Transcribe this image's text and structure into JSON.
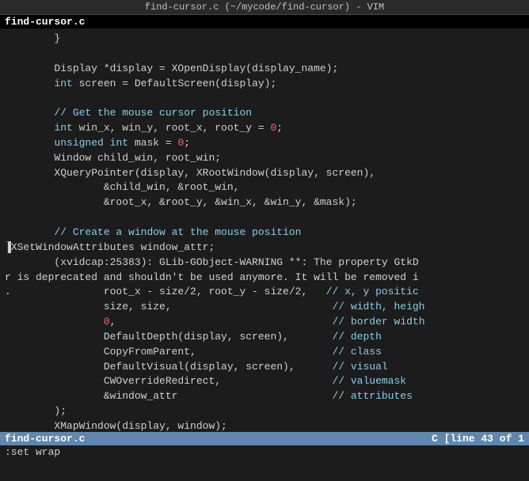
{
  "titleBar": {
    "text": "find-cursor.c (~/mycode/find-cursor) - VIM"
  },
  "filenameBar": {
    "text": "find-cursor.c"
  },
  "statusBar": {
    "left": "find-cursor.c",
    "right": "C [line 43 of 1"
  },
  "cmdBar": {
    "text": ":set wrap"
  },
  "code": {
    "lines": [
      {
        "text": "        }",
        "parts": [
          {
            "t": "        }",
            "cls": "plain"
          }
        ]
      },
      {
        "text": "",
        "parts": []
      },
      {
        "text": "        Display *display = XOpenDisplay(display_name);",
        "parts": [
          {
            "t": "        Display *display = XOpenDisplay(display_name);",
            "cls": "plain"
          }
        ]
      },
      {
        "text": "        int screen = DefaultScreen(display);",
        "parts": [
          {
            "t": "        ",
            "cls": "plain"
          },
          {
            "t": "int",
            "cls": "kw"
          },
          {
            "t": " screen = DefaultScreen(display);",
            "cls": "plain"
          }
        ]
      },
      {
        "text": "",
        "parts": []
      },
      {
        "text": "        // Get the mouse cursor position",
        "parts": [
          {
            "t": "        ",
            "cls": "plain"
          },
          {
            "t": "// Get the mouse cursor position",
            "cls": "cm"
          }
        ]
      },
      {
        "text": "        int win_x, win_y, root_x, root_y = 0;",
        "parts": [
          {
            "t": "        ",
            "cls": "plain"
          },
          {
            "t": "int",
            "cls": "kw"
          },
          {
            "t": " win_x, win_y, root_x, root_y = ",
            "cls": "plain"
          },
          {
            "t": "0",
            "cls": "num"
          },
          {
            "t": ";",
            "cls": "plain"
          }
        ]
      },
      {
        "text": "        unsigned int mask = 0;",
        "parts": [
          {
            "t": "        ",
            "cls": "plain"
          },
          {
            "t": "unsigned",
            "cls": "kw"
          },
          {
            "t": " ",
            "cls": "plain"
          },
          {
            "t": "int",
            "cls": "kw"
          },
          {
            "t": " mask = ",
            "cls": "plain"
          },
          {
            "t": "0",
            "cls": "num"
          },
          {
            "t": ";",
            "cls": "plain"
          }
        ]
      },
      {
        "text": "        Window child_win, root_win;",
        "parts": [
          {
            "t": "        Window child_win, root_win;",
            "cls": "plain"
          }
        ]
      },
      {
        "text": "        XQueryPointer(display, XRootWindow(display, screen),",
        "parts": [
          {
            "t": "        XQueryPointer(display, XRootWindow(display, screen),",
            "cls": "plain"
          }
        ]
      },
      {
        "text": "                &child_win, &root_win,",
        "parts": [
          {
            "t": "                &child_win, &root_win,",
            "cls": "plain"
          }
        ]
      },
      {
        "text": "                &root_x, &root_y, &win_x, &win_y, &mask);",
        "parts": [
          {
            "t": "                &root_x, &root_y, &win_x, &win_y, &mask);",
            "cls": "plain"
          }
        ]
      },
      {
        "text": "",
        "parts": []
      },
      {
        "text": "        // Create a window at the mouse position",
        "parts": [
          {
            "t": "        ",
            "cls": "plain"
          },
          {
            "t": "// Create a window at the mouse position",
            "cls": "cm"
          }
        ]
      },
      {
        "text": "▌XSetWindowAttributes window_attr;",
        "parts": [
          {
            "t": "▌",
            "cls": "cursor-block"
          },
          {
            "t": "XSetWindowAttributes window_attr;",
            "cls": "plain"
          }
        ]
      },
      {
        "text": "        (xvidcap:25383): GLib-GObject-WARNING **: The property GtkD",
        "parts": [
          {
            "t": "        (xvidcap:25383): GLib-GObject-WARNING **: The property GtkD",
            "cls": "warn"
          }
        ]
      },
      {
        "text": "r is deprecated and shouldn't be used anymore. It will be removed i",
        "parts": [
          {
            "t": "r is deprecated and shouldn't be used anymore. It will be removed i",
            "cls": "warn"
          }
        ]
      },
      {
        "text": ".               root_x - size/2, root_y - size/2,   // x, y positic",
        "parts": [
          {
            "t": ".               root_x - size/2, root_y - size/2,   ",
            "cls": "plain"
          },
          {
            "t": "// x, y positic",
            "cls": "cm"
          }
        ]
      },
      {
        "text": "                size, size,                          // width, heigh",
        "parts": [
          {
            "t": "                size, size,                          ",
            "cls": "plain"
          },
          {
            "t": "// width, heigh",
            "cls": "cm"
          }
        ]
      },
      {
        "text": "                0,                                   // border width",
        "parts": [
          {
            "t": "                ",
            "cls": "plain"
          },
          {
            "t": "0",
            "cls": "num"
          },
          {
            "t": ",                                   ",
            "cls": "plain"
          },
          {
            "t": "// border width",
            "cls": "cm"
          }
        ]
      },
      {
        "text": "                DefaultDepth(display, screen),       // depth",
        "parts": [
          {
            "t": "                DefaultDepth(display, screen),       ",
            "cls": "plain"
          },
          {
            "t": "// depth",
            "cls": "cm"
          }
        ]
      },
      {
        "text": "                CopyFromParent,                      // class",
        "parts": [
          {
            "t": "                CopyFromParent,                      ",
            "cls": "plain"
          },
          {
            "t": "// class",
            "cls": "cm"
          }
        ]
      },
      {
        "text": "                DefaultVisual(display, screen),      // visual",
        "parts": [
          {
            "t": "                DefaultVisual(display, screen),      ",
            "cls": "plain"
          },
          {
            "t": "// visual",
            "cls": "cm"
          }
        ]
      },
      {
        "text": "                CWOverrideRedirect,                  // valuemask",
        "parts": [
          {
            "t": "                CWOverrideRedirect,                  ",
            "cls": "plain"
          },
          {
            "t": "// valuemask",
            "cls": "cm"
          }
        ]
      },
      {
        "text": "                &window_attr                         // attributes",
        "parts": [
          {
            "t": "                &window_attr                         ",
            "cls": "plain"
          },
          {
            "t": "// attributes",
            "cls": "cm"
          }
        ]
      },
      {
        "text": "        );",
        "parts": [
          {
            "t": "        );",
            "cls": "plain"
          }
        ]
      },
      {
        "text": "        XMapWindow(display, window);",
        "parts": [
          {
            "t": "        XMapWindow(display, window);",
            "cls": "plain"
          }
        ]
      }
    ]
  }
}
